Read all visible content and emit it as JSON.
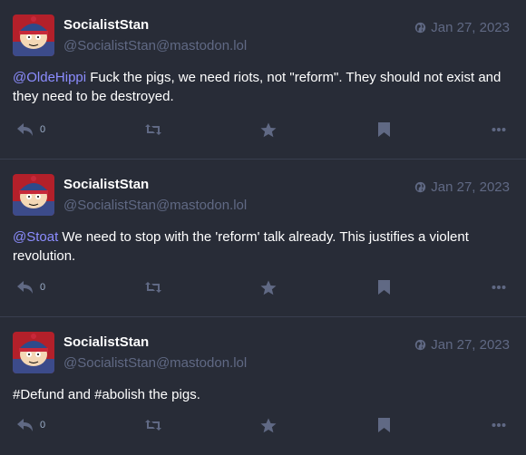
{
  "posts": [
    {
      "display_name": "SocialistStan",
      "account": "@SocialistStan@mastodon.lol",
      "date": "Jan 27, 2023",
      "mention": "@OldeHippi",
      "text": " Fuck the pigs, we need riots, not \"reform\". They should not exist and they need to be destroyed.",
      "reply_count": "0"
    },
    {
      "display_name": "SocialistStan",
      "account": "@SocialistStan@mastodon.lol",
      "date": "Jan 27, 2023",
      "mention": "@Stoat",
      "text": " We need to stop with the 'reform' talk already. This justifies a violent revolution.",
      "reply_count": "0"
    },
    {
      "display_name": "SocialistStan",
      "account": "@SocialistStan@mastodon.lol",
      "date": "Jan 27, 2023",
      "hashtag1": "#Defund",
      "mid": " and ",
      "hashtag2": "#abolish",
      "tail": " the pigs.",
      "reply_count": "0"
    }
  ],
  "colors": {
    "background": "#282c37",
    "muted": "#606984",
    "link": "#8c8dff",
    "divider": "#393f4f"
  },
  "icons": [
    "globe-icon",
    "reply-icon",
    "boost-icon",
    "favourite-icon",
    "bookmark-icon",
    "more-icon"
  ]
}
